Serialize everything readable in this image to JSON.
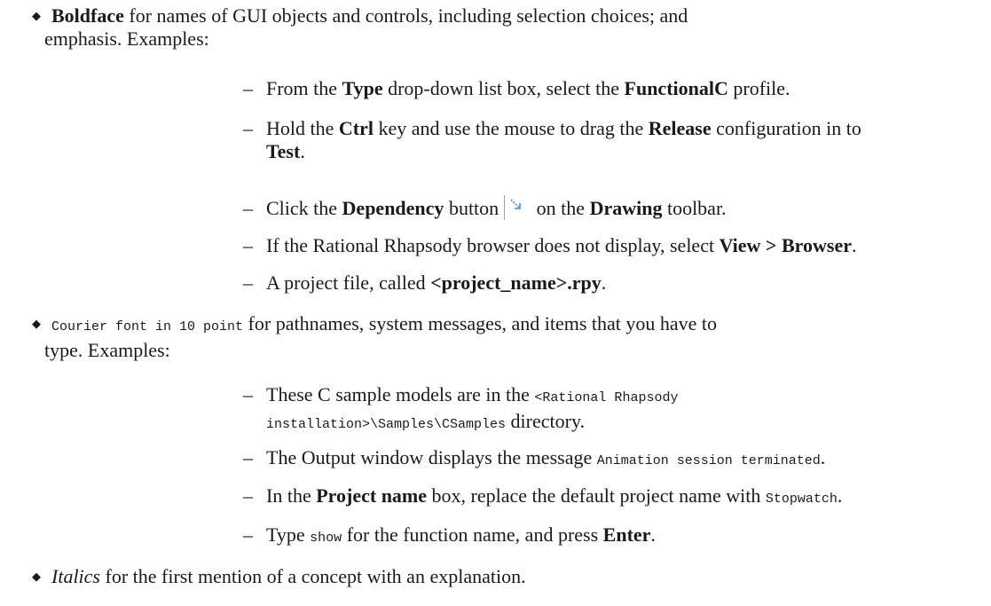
{
  "bullets": {
    "boldface": {
      "term": "Boldface",
      "rest_line1": " for names of GUI objects and controls, including selection choices; and",
      "line2": "emphasis. Examples:"
    },
    "courier": {
      "term": "Courier font in 10 point",
      "rest_line1": " for pathnames, system messages, and items that you have to",
      "line2": "type. Examples:"
    },
    "italics": {
      "term": "Italics",
      "rest": " for the first mention of a concept with an explanation."
    }
  },
  "bold_examples": {
    "ex1": {
      "t1": "From the ",
      "b1": "Type",
      "t2": " drop-down list box, select the ",
      "b2": "FunctionalC",
      "t3": " profile."
    },
    "ex2": {
      "t1": "Hold the ",
      "b1": "Ctrl",
      "t2": " key and use the mouse to drag the ",
      "b2": "Release",
      "t3": " configuration in to",
      "b3": "Test",
      "t4": "."
    },
    "ex3": {
      "t1": "Click the ",
      "b1": "Dependency",
      "t2": " button",
      "t3": " on the ",
      "b2": "Drawing",
      "t4": " toolbar."
    },
    "ex4": {
      "t1": "If the Rational Rhapsody browser does not display, select ",
      "b1": "View > Browser",
      "t2": "."
    },
    "ex5": {
      "t1": "A project file, called ",
      "b1": "<project_name>.rpy",
      "t2": "."
    }
  },
  "courier_examples": {
    "ex1": {
      "t1": "These C sample models are in the ",
      "m1": "<Rational Rhapsody",
      "m2": "installation>\\Samples\\CSamples",
      "t2": " directory."
    },
    "ex2": {
      "t1": "The Output window displays the message ",
      "m1": "Animation session terminated",
      "t2": "."
    },
    "ex3": {
      "t1": "In the ",
      "b1": "Project name",
      "t2": " box, replace the default project name with ",
      "m1": "Stopwatch",
      "t3": "."
    },
    "ex4": {
      "t1": "Type ",
      "m1": "show",
      "t2": " for the function name, and press ",
      "b1": "Enter",
      "t3": "."
    }
  },
  "dash": "–",
  "bullet_glyph": "◆",
  "icon_color": "#3a8fd8"
}
